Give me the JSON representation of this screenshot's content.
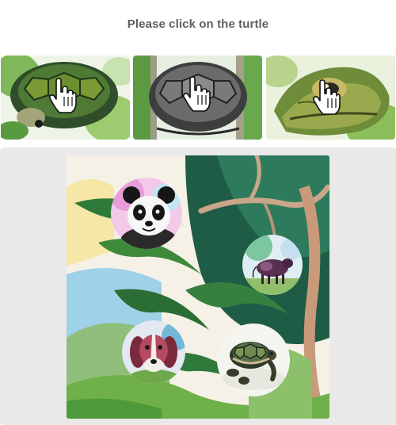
{
  "instruction": "Please click on the turtle",
  "examples": [
    {
      "name": "example-turtle-shell-green",
      "icon": "turtle-shell-icon"
    },
    {
      "name": "example-turtle-shell-grey",
      "icon": "turtle-shell-icon"
    },
    {
      "name": "example-turtle-head",
      "icon": "turtle-head-icon"
    }
  ],
  "scene_animals": [
    "panda",
    "cow",
    "dog",
    "turtle"
  ],
  "cursor_icon": "pointing-hand-icon",
  "colors": {
    "prompt_text": "#5f5f5f",
    "panel_background": "#e9e9e9",
    "foliage": "#2e7a3a",
    "sky": "#9fd1e8"
  }
}
